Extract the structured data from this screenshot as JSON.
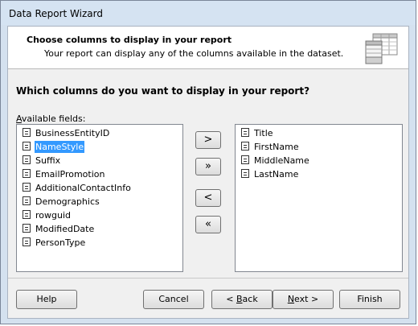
{
  "window": {
    "title": "Data Report Wizard"
  },
  "header": {
    "title": "Choose columns to display in your report",
    "subtitle": "Your report can display any of the columns available in the dataset.",
    "icon": "table-columns-icon"
  },
  "question": "Which columns do you want to display in your report?",
  "available": {
    "label_prefix": "A",
    "label_rest": "vailable fields:",
    "items": [
      "BusinessEntityID",
      "NameStyle",
      "Suffix",
      "EmailPromotion",
      "AdditionalContactInfo",
      "Demographics",
      "rowguid",
      "ModifiedDate",
      "PersonType"
    ],
    "selected": "NameStyle"
  },
  "selected_fields": {
    "items": [
      "Title",
      "FirstName",
      "MiddleName",
      "LastName"
    ]
  },
  "arrows": {
    "add": ">",
    "add_all": "»",
    "remove": "<",
    "remove_all": "«"
  },
  "buttons": {
    "help": "Help",
    "cancel": "Cancel",
    "back_prefix": "< ",
    "back_mnemonic": "B",
    "back_rest": "ack",
    "next_mnemonic": "N",
    "next_rest": "ext >",
    "finish": "Finish"
  }
}
